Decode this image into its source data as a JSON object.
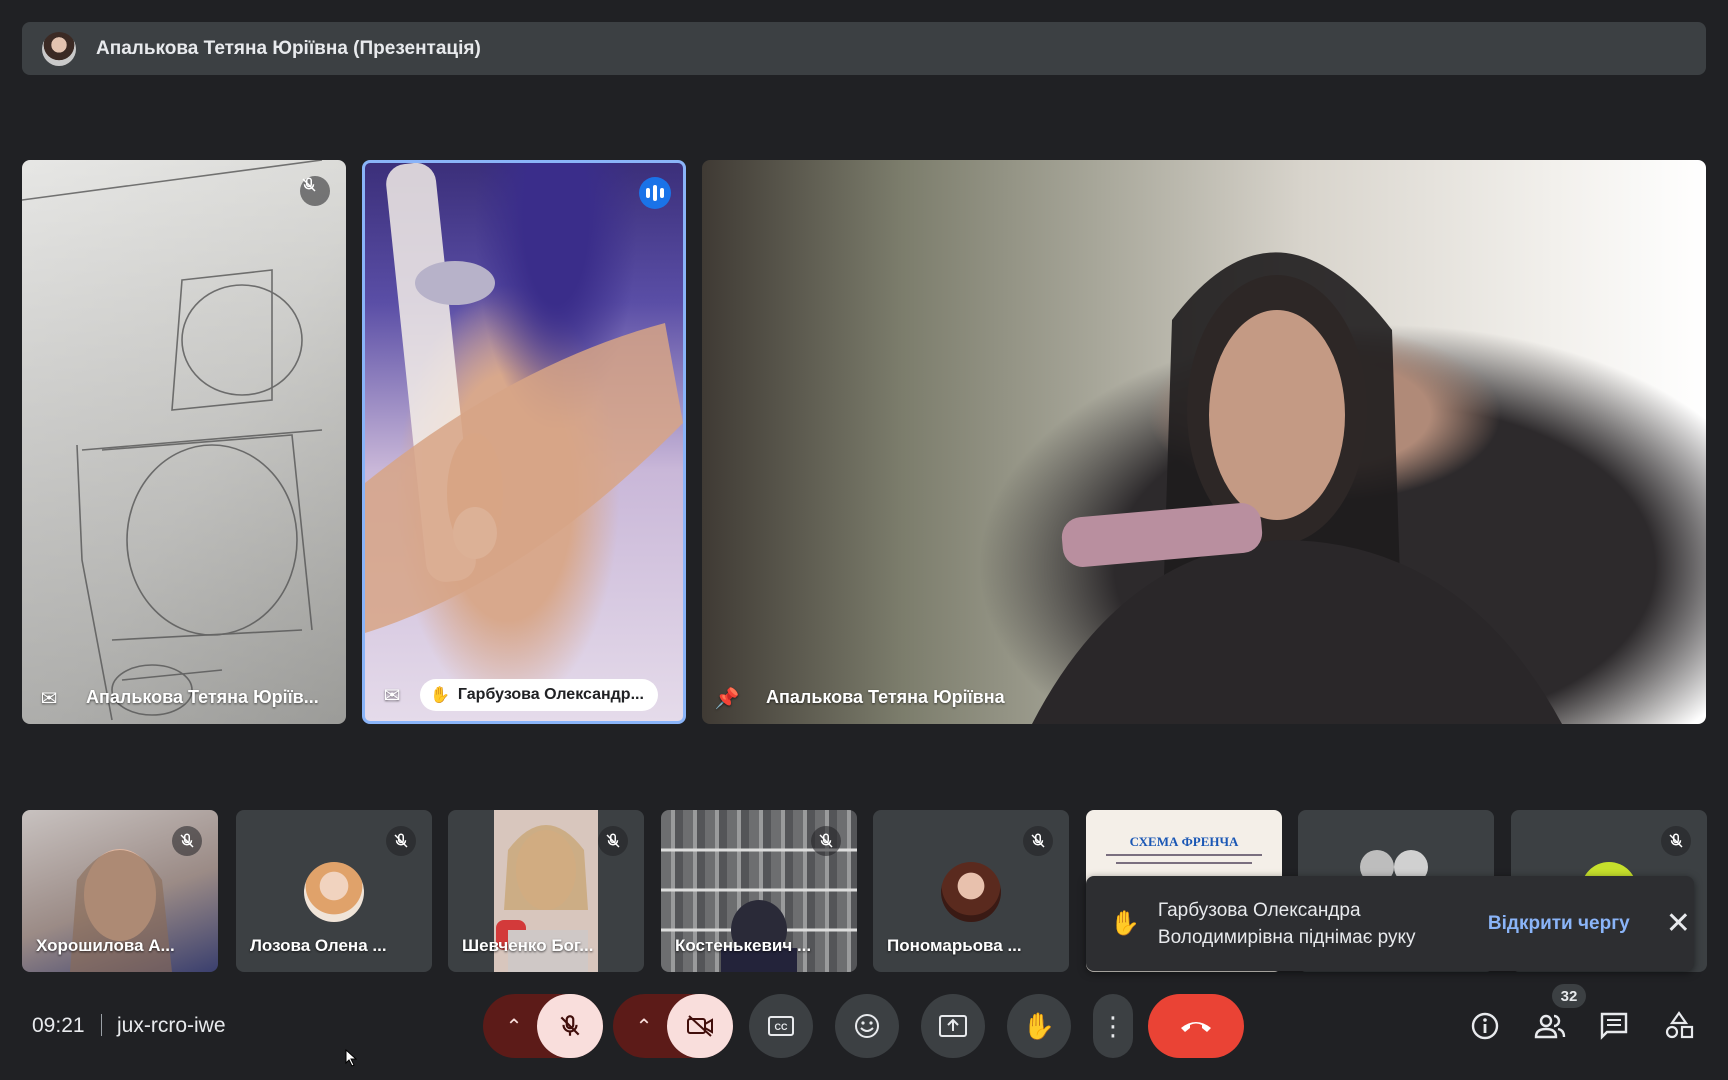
{
  "presentation": {
    "title": "Апалькова Тетяна Юріївна (Презентація)"
  },
  "main_tiles": [
    {
      "name": "Апалькова Тетяна Юріїв..."
    },
    {
      "name": "Гарбузова Олександр..."
    },
    {
      "name": "Апалькова Тетяна Юріївна"
    }
  ],
  "strip": [
    {
      "name": "Хорошилова А..."
    },
    {
      "name": "Лозова Олена ..."
    },
    {
      "name": "Шевченко Бог..."
    },
    {
      "name": "Костенькевич ..."
    },
    {
      "name": "Пономарьова ..."
    },
    {
      "slide_title": "СХЕМА ФРЕНЧА"
    },
    {
      "name": ""
    },
    {
      "name": ""
    }
  ],
  "notification": {
    "text_line1": "Гарбузова Олександра",
    "text_line2": "Володимирівна піднімає руку",
    "action": "Відкрити чергу"
  },
  "footer": {
    "time": "09:21",
    "meeting_code": "jux-rcro-iwe",
    "participants_count": "32"
  },
  "colors": {
    "background": "#202124",
    "accent": "#8ab4f8",
    "end_call": "#ea4335",
    "muted_bg": "#f9dedc"
  }
}
